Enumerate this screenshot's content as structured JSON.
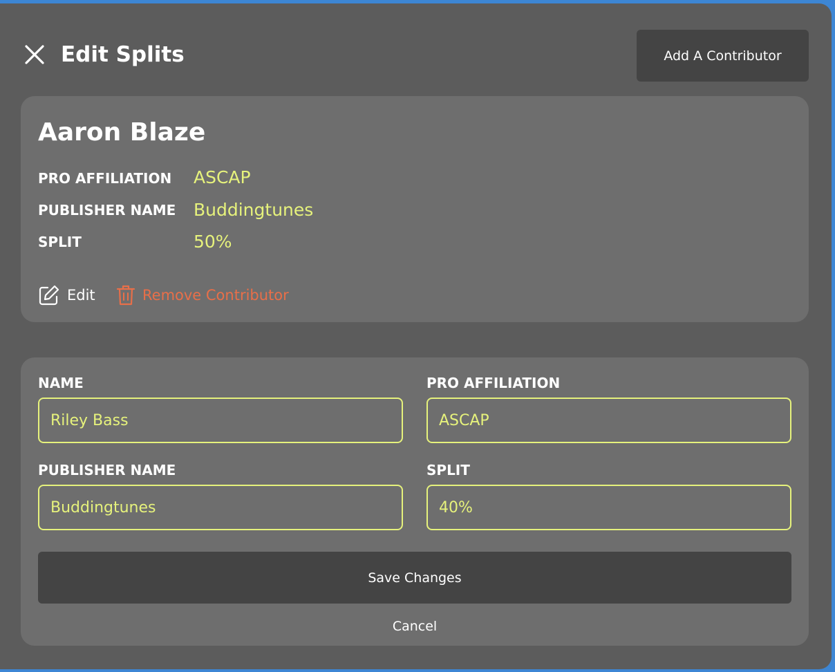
{
  "header": {
    "title": "Edit Splits",
    "add_button_label": "Add A Contributor",
    "close_icon": "close-icon"
  },
  "contributor_card": {
    "name": "Aaron Blaze",
    "fields": [
      {
        "label": "PRO AFFILIATION",
        "value": "ASCAP"
      },
      {
        "label": "PUBLISHER NAME",
        "value": "Buddingtunes"
      },
      {
        "label": "SPLIT",
        "value": "50%"
      }
    ],
    "edit_label": "Edit",
    "remove_label": "Remove Contributor",
    "edit_icon": "edit-icon",
    "remove_icon": "trash-icon"
  },
  "form": {
    "name_label": "NAME",
    "name_value": "Riley Bass",
    "pro_label": "PRO AFFILIATION",
    "pro_value": "ASCAP",
    "publisher_label": "PUBLISHER NAME",
    "publisher_value": "Buddingtunes",
    "split_label": "SPLIT",
    "split_value": "40%",
    "save_label": "Save Changes",
    "cancel_label": "Cancel"
  },
  "colors": {
    "accent": "#e6f27c",
    "danger": "#e86f49",
    "modal_bg": "#5c5c5c",
    "card_bg": "#6e6e6e",
    "button_bg": "#444444",
    "frame": "#3d86d4"
  }
}
